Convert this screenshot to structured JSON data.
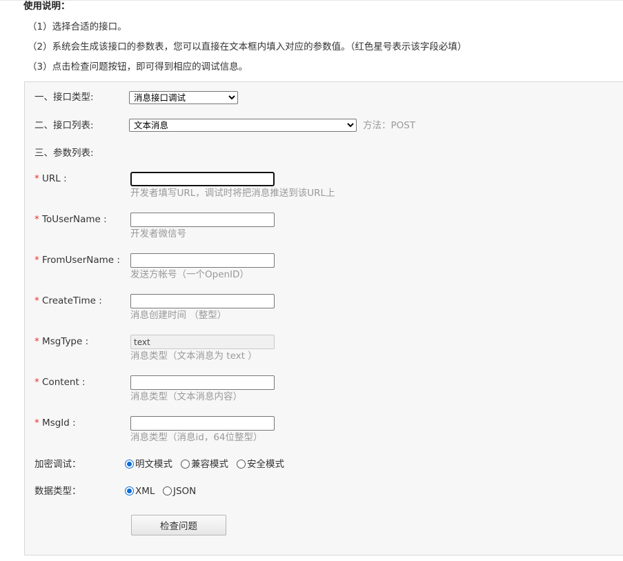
{
  "usage": {
    "title": "使用说明：",
    "steps": [
      "（1）选择合适的接口。",
      "（2）系统会生成该接口的参数表，您可以直接在文本框内填入对应的参数值。（红色星号表示该字段必填）",
      "（3）点击检查问题按钮，即可得到相应的调试信息。"
    ]
  },
  "form": {
    "interface_type_label": "一、接口类型:",
    "interface_type_value": "消息接口调试",
    "interface_list_label": "二、接口列表:",
    "interface_list_value": "文本消息",
    "method_text": "方法：POST",
    "param_list_label": "三、参数列表:",
    "required_mark": "*",
    "fields": [
      {
        "label": "URL :",
        "value": "",
        "hint": "开发者填写URL，调试时将把消息推送到该URL上"
      },
      {
        "label": "ToUserName :",
        "value": "",
        "hint": "开发者微信号"
      },
      {
        "label": "FromUserName :",
        "value": "",
        "hint": "发送方帐号（一个OpenID）"
      },
      {
        "label": "CreateTime :",
        "value": "",
        "hint": "消息创建时间 （整型）"
      },
      {
        "label": "MsgType :",
        "value": "text",
        "hint": "消息类型（文本消息为 text ）"
      },
      {
        "label": "Content :",
        "value": "",
        "hint": "消息类型（文本消息内容）"
      },
      {
        "label": "MsgId :",
        "value": "",
        "hint": "消息类型（消息id，64位整型）"
      }
    ],
    "encrypt_label": "加密调试：",
    "encrypt_options": [
      "明文模式",
      "兼容模式",
      "安全模式"
    ],
    "encrypt_selected": "明文模式",
    "data_type_label": "数据类型：",
    "data_type_options": [
      "XML",
      "JSON"
    ],
    "data_type_selected": "XML",
    "check_button": "检查问题"
  },
  "colors": {
    "required_star": "#e0322e",
    "hint_text": "#999999",
    "panel_bg": "#f7f7f7",
    "radio_accent": "#0a6cd8"
  }
}
